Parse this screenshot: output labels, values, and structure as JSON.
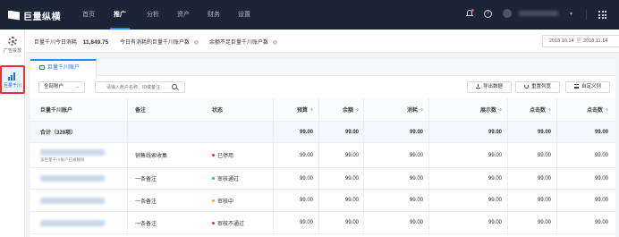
{
  "topnav": {
    "brand": "巨量纵横",
    "items": [
      {
        "label": "首页",
        "active": false
      },
      {
        "label": "推广",
        "active": true
      },
      {
        "label": "分析",
        "active": false
      },
      {
        "label": "资产",
        "active": false
      },
      {
        "label": "财务",
        "active": false
      },
      {
        "label": "设置",
        "active": false
      }
    ],
    "help_glyph": "?",
    "caret": "▾"
  },
  "sidebar": {
    "items": [
      {
        "label": "广告投放",
        "icon": "gear-icon",
        "active": false
      },
      {
        "label": "巨量千川",
        "icon": "bar-chart-icon",
        "active": true
      }
    ]
  },
  "summary": {
    "today_spend_label": "巨量千川今日消耗",
    "today_spend_value": "11,849.75",
    "budget_label": "今日有消耗的巨量千川账户数",
    "balance_label": "余额不足巨量千川账户数",
    "date_start": "2018.10.14",
    "date_sep": "至",
    "date_end": "2018.11.14"
  },
  "tab": {
    "label": "巨量千川账户"
  },
  "toolbar": {
    "filter_select": "全部账户",
    "filter_caret": "⌄",
    "search_placeholder": "请输入账户名称、ID或备注",
    "download_label": "导出数据",
    "reset_label": "重置列宽",
    "columns_label": "自定义列"
  },
  "table": {
    "headers": [
      "巨量千川账户",
      "备注",
      "状态",
      "预算",
      "余额",
      "消耗",
      "展示数",
      "点击数",
      "点击数"
    ],
    "total": {
      "label": "合计（329项）",
      "values": [
        "99.00",
        "99.00",
        "99.00",
        "99.00",
        "99.00",
        "99.00"
      ]
    },
    "rows": [
      {
        "sub": "该巨量千川账户已被删除",
        "remark": "销售线索收集",
        "status": "已停用",
        "status_color": "#e5322d",
        "values": [
          "99.00",
          "99.00",
          "99.00",
          "99.00",
          "99.00",
          "99.00"
        ]
      },
      {
        "sub": "",
        "remark": "一条备注",
        "status": "审核通过",
        "status_color": "#2dbe60",
        "values": [
          "99.00",
          "99.00",
          "99.00",
          "99.00",
          "99.00",
          "99.00"
        ]
      },
      {
        "sub": "",
        "remark": "一条备注",
        "status": "审核中",
        "status_color": "#f5a623",
        "values": [
          "99.00",
          "99.00",
          "99.00",
          "99.00",
          "99.00",
          "99.00"
        ]
      },
      {
        "sub": "",
        "remark": "一条备注",
        "status": "审核不通过",
        "status_color": "#e5322d",
        "values": [
          "99.00",
          "99.00",
          "99.00",
          "99.00",
          "99.00",
          "99.00"
        ]
      }
    ]
  }
}
